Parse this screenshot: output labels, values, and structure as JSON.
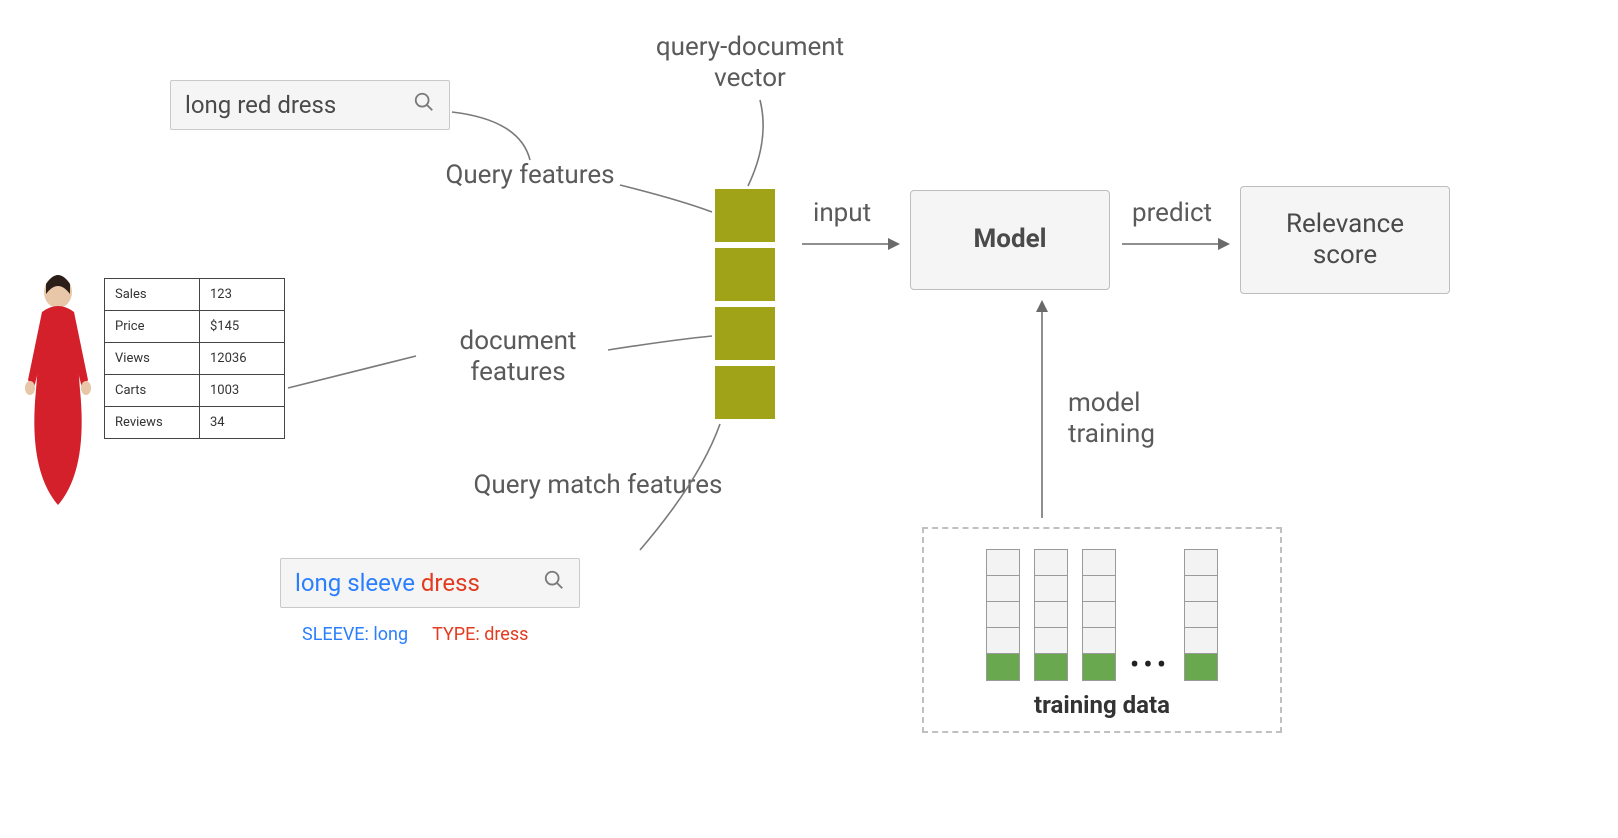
{
  "search_top": {
    "query": "long red dress"
  },
  "search_bottom": {
    "term1": "long sleeve",
    "term2": "dress",
    "attr_sleeve_label": "SLEEVE:",
    "attr_sleeve_value": "long",
    "attr_type_label": "TYPE:",
    "attr_type_value": "dress"
  },
  "labels": {
    "query_doc_vector": "query-document vector",
    "query_features": "Query features",
    "document_features": "document features",
    "query_match_features": "Query match features",
    "input": "input",
    "predict": "predict",
    "model_training": "model training"
  },
  "nodes": {
    "model": "Model",
    "relevance": "Relevance score"
  },
  "training": {
    "caption": "training data"
  },
  "product": {
    "rows": [
      {
        "k": "Sales",
        "v": "123"
      },
      {
        "k": "Price",
        "v": "$145"
      },
      {
        "k": "Views",
        "v": "12036"
      },
      {
        "k": "Carts",
        "v": "1003"
      },
      {
        "k": "Reviews",
        "v": "34"
      }
    ]
  },
  "colors": {
    "vector_block": "#a0a318",
    "train_green": "#6aa84f",
    "query_blue": "#2a7fff",
    "query_red": "#e23b1f"
  }
}
